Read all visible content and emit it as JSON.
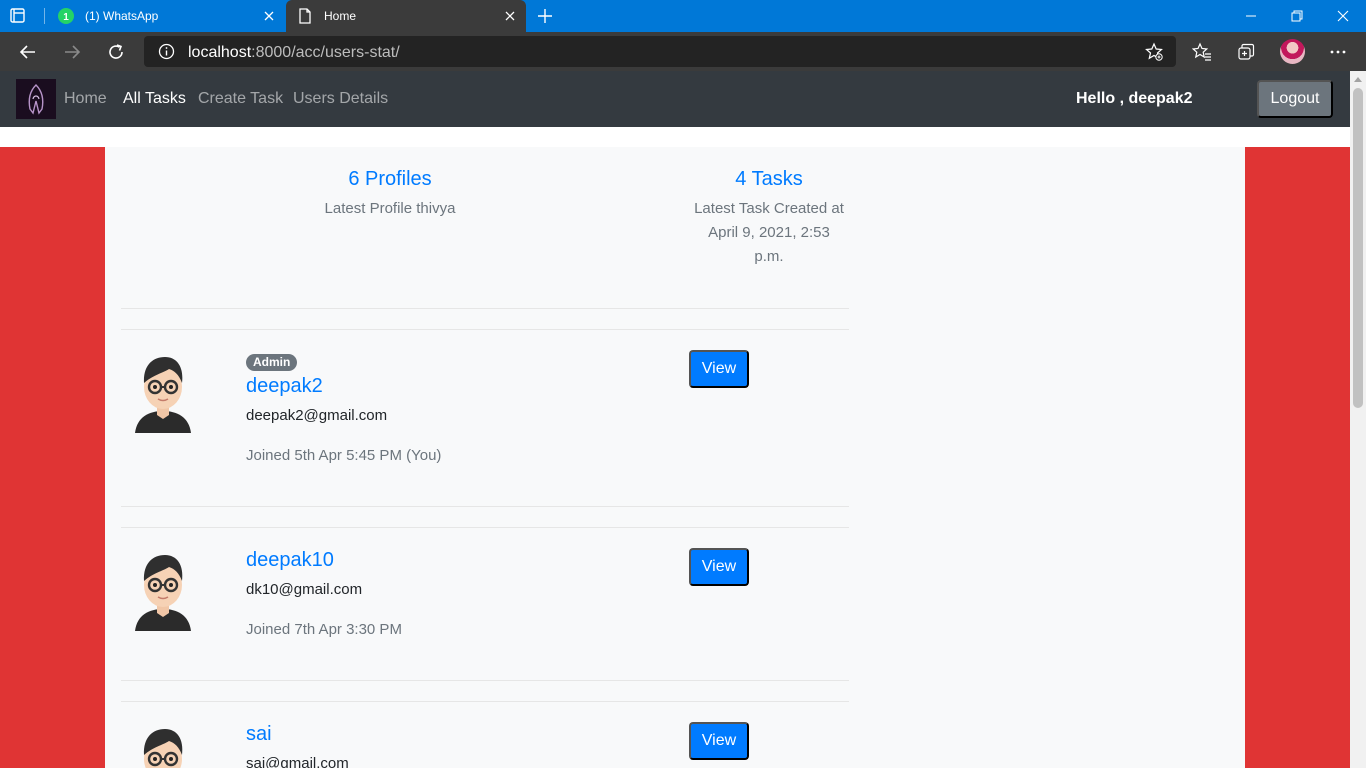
{
  "browser": {
    "tabs": [
      {
        "title": "(1) WhatsApp",
        "active": false,
        "icon": "whatsapp-icon"
      },
      {
        "title": "Home",
        "active": true,
        "icon": "page-icon"
      }
    ],
    "url_host": "localhost",
    "url_rest": ":8000/acc/users-stat/",
    "accent": "#0078d7"
  },
  "navbar": {
    "links": [
      "Home",
      "All Tasks",
      "Create Task",
      "Users Details"
    ],
    "active_link": "All Tasks",
    "greeting": "Hello , deepak2",
    "logout_label": "Logout"
  },
  "stats": {
    "profiles_count": "6 Profiles",
    "profiles_sub": "Latest Profile thivya",
    "tasks_count": "4 Tasks",
    "tasks_sub_lines": [
      "Latest Task Created at",
      "April 9, 2021, 2:53",
      "p.m."
    ]
  },
  "users": [
    {
      "badge": "Admin",
      "name": "deepak2",
      "email": "deepak2@gmail.com",
      "joined": "Joined 5th Apr 5:45 PM (You)",
      "view_label": "View"
    },
    {
      "badge": "",
      "name": "deepak10",
      "email": "dk10@gmail.com",
      "joined": "Joined 7th Apr 3:30 PM",
      "view_label": "View"
    },
    {
      "badge": "",
      "name": "sai",
      "email": "sai@gmail.com",
      "joined": "",
      "view_label": "View"
    }
  ],
  "colors": {
    "page_bg": "#e03434",
    "panel_bg": "#f8f9fa",
    "link_blue": "#007bff",
    "navbar_bg": "#343a40"
  }
}
